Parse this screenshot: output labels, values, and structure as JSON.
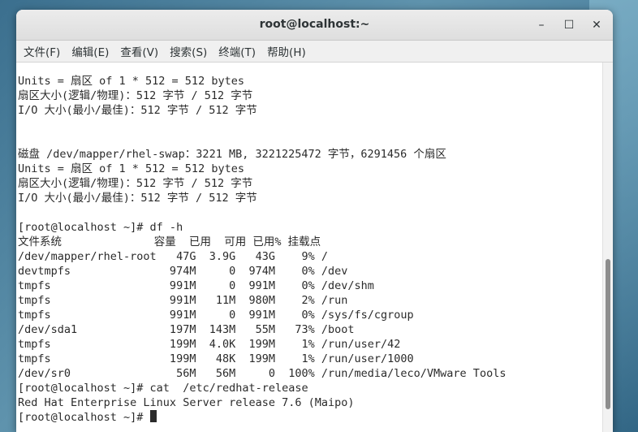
{
  "window": {
    "title": "root@localhost:~",
    "buttons": {
      "minimize": "–",
      "maximize": "☐",
      "close": "✕"
    }
  },
  "menu": [
    {
      "label": "文件(F)"
    },
    {
      "label": "编辑(E)"
    },
    {
      "label": "查看(V)"
    },
    {
      "label": "搜索(S)"
    },
    {
      "label": "终端(T)"
    },
    {
      "label": "帮助(H)"
    }
  ],
  "terminal": {
    "lines": [
      "Units = 扇区 of 1 * 512 = 512 bytes",
      "扇区大小(逻辑/物理)：512 字节 / 512 字节",
      "I/O 大小(最小/最佳)：512 字节 / 512 字节",
      "",
      "",
      "磁盘 /dev/mapper/rhel-swap：3221 MB, 3221225472 字节，6291456 个扇区",
      "Units = 扇区 of 1 * 512 = 512 bytes",
      "扇区大小(逻辑/物理)：512 字节 / 512 字节",
      "I/O 大小(最小/最佳)：512 字节 / 512 字节",
      "",
      "[root@localhost ~]# df -h",
      "文件系统              容量  已用  可用 已用% 挂载点",
      "/dev/mapper/rhel-root   47G  3.9G   43G    9% /",
      "devtmpfs               974M     0  974M    0% /dev",
      "tmpfs                  991M     0  991M    0% /dev/shm",
      "tmpfs                  991M   11M  980M    2% /run",
      "tmpfs                  991M     0  991M    0% /sys/fs/cgroup",
      "/dev/sda1              197M  143M   55M   73% /boot",
      "tmpfs                  199M  4.0K  199M    1% /run/user/42",
      "tmpfs                  199M   48K  199M    1% /run/user/1000",
      "/dev/sr0                56M   56M     0  100% /run/media/leco/VMware Tools",
      "[root@localhost ~]# cat  /etc/redhat-release",
      "Red Hat Enterprise Linux Server release 7.6 (Maipo)"
    ],
    "prompt": "[root@localhost ~]# "
  }
}
